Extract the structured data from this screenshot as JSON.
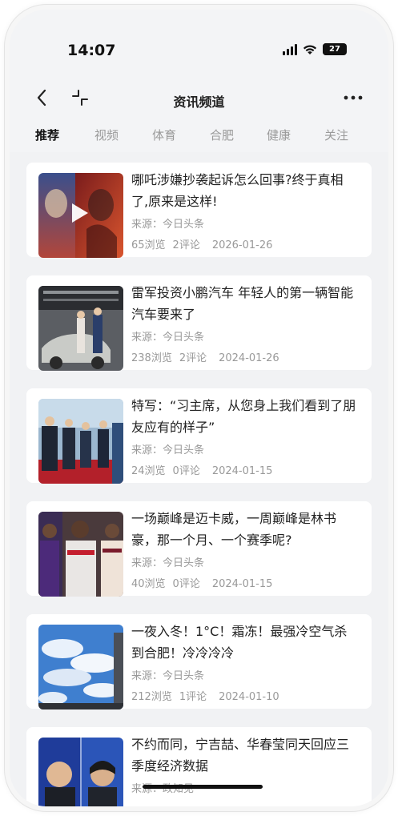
{
  "status_bar": {
    "time": "14:07",
    "battery": "27",
    "battery_level": 0.27
  },
  "nav": {
    "title": "资讯频道"
  },
  "tabs": [
    {
      "label": "推荐",
      "active": true
    },
    {
      "label": "视频",
      "active": false
    },
    {
      "label": "体育",
      "active": false
    },
    {
      "label": "合肥",
      "active": false
    },
    {
      "label": "健康",
      "active": false
    },
    {
      "label": "关注",
      "active": false
    }
  ],
  "articles": [
    {
      "title": "哪吒涉嫌抄袭起诉怎么回事?终于真相了,原来是这样!",
      "source": "来源：今日头条",
      "views": "65浏览",
      "comments": "2评论",
      "date": "2026-01-26",
      "has_video": true
    },
    {
      "title": "雷军投资小鹏汽车 年轻人的第一辆智能汽车要来了",
      "source": "来源：今日头条",
      "views": "238浏览",
      "comments": "2评论",
      "date": "2024-01-26",
      "has_video": false
    },
    {
      "title": "特写：“习主席，从您身上我们看到了朋友应有的样子”",
      "source": "来源：今日头条",
      "views": "24浏览",
      "comments": "0评论",
      "date": "2024-01-15",
      "has_video": false
    },
    {
      "title": "一场巅峰是迈卡威，一周巅峰是林书豪，那一个月、一个赛季呢?",
      "source": "来源：今日头条",
      "views": "40浏览",
      "comments": "0评论",
      "date": "2024-01-15",
      "has_video": false
    },
    {
      "title": "一夜入冬！1°C！霜冻！最强冷空气杀到合肥！冷冷冷冷",
      "source": "来源：今日头条",
      "views": "212浏览",
      "comments": "1评论",
      "date": "2024-01-10",
      "has_video": false
    },
    {
      "title": "不约而同，宁吉喆、华春莹同天回应三季度经济数据",
      "source": "来源：政知见",
      "views": "",
      "comments": "",
      "date": "",
      "has_video": false
    }
  ],
  "icons": {
    "back": "chevron-left-icon",
    "shrink": "collapse-icon",
    "more": "ellipsis-icon",
    "signal": "cellular-signal-icon",
    "wifi": "wifi-icon",
    "battery": "battery-icon",
    "play": "play-icon"
  }
}
